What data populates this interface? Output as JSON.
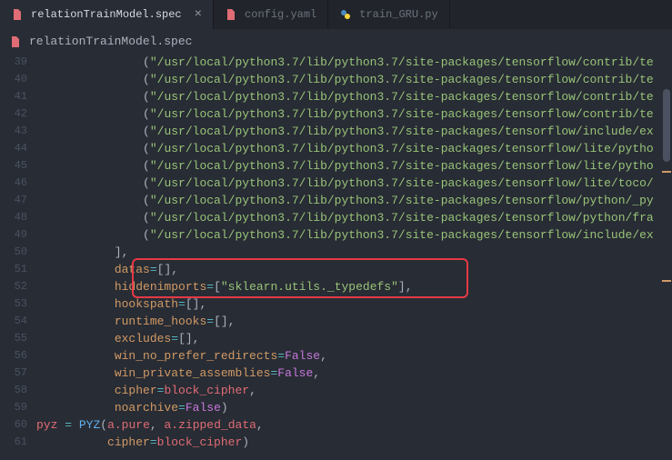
{
  "tabs": [
    {
      "label": "relationTrainModel.spec",
      "active": true
    },
    {
      "label": "config.yaml",
      "active": false
    },
    {
      "label": "train_GRU.py",
      "active": false
    }
  ],
  "subheader": {
    "filename": "relationTrainModel.spec"
  },
  "gutter": {
    "start": 39,
    "end": 61
  },
  "code": {
    "path_prefix": "/usr/local/python3.7/lib/python3.7/site-packages/tensorflow/",
    "line39": "contrib/te",
    "line40": "contrib/te",
    "line41": "contrib/te",
    "line42": "contrib/te",
    "line43": "include/ex",
    "line44": "lite/pytho",
    "line45": "lite/pytho",
    "line46": "lite/toco/",
    "line47": "python/_py",
    "line48": "python/fra",
    "line49": "include/ex",
    "datas_label": "datas",
    "datas_val_open": "[",
    "datas_val_close": "]",
    "hidden_label": "hiddenimports",
    "hidden_val": "\"sklearn.utils._typedefs\"",
    "hooks_label": "hookspath",
    "runtime_label": "runtime_hooks",
    "excludes_label": "excludes",
    "noprefer_label": "win_no_prefer_redirects",
    "noprefer_val": "False",
    "winpriv_label": "win_private_assemblies",
    "winpriv_val": "False",
    "cipher_label": "cipher",
    "cipher_val": "block_cipher",
    "noarch_label": "noarchive",
    "noarch_val": "False",
    "pyz_var": "pyz",
    "pyz_fn": "PYZ",
    "a_pure": "a.pure",
    "a_zipped": "a.zipped_data",
    "cipher2_label": "cipher",
    "cipher2_val": "block_cipher"
  }
}
